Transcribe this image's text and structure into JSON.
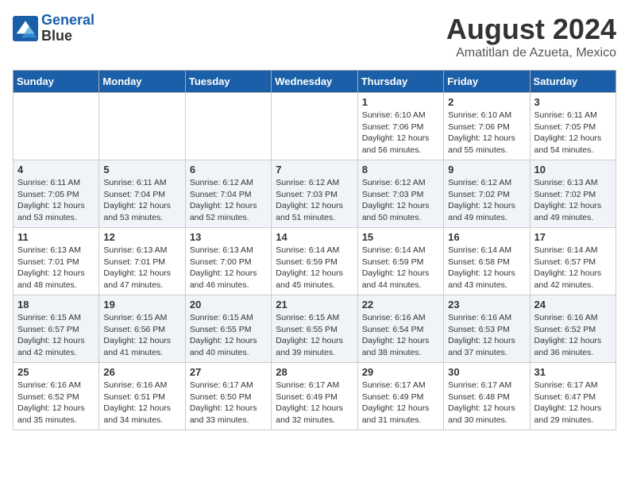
{
  "header": {
    "logo_line1": "General",
    "logo_line2": "Blue",
    "month_year": "August 2024",
    "location": "Amatitlan de Azueta, Mexico"
  },
  "days_of_week": [
    "Sunday",
    "Monday",
    "Tuesday",
    "Wednesday",
    "Thursday",
    "Friday",
    "Saturday"
  ],
  "weeks": [
    [
      {
        "num": "",
        "info": ""
      },
      {
        "num": "",
        "info": ""
      },
      {
        "num": "",
        "info": ""
      },
      {
        "num": "",
        "info": ""
      },
      {
        "num": "1",
        "info": "Sunrise: 6:10 AM\nSunset: 7:06 PM\nDaylight: 12 hours\nand 56 minutes."
      },
      {
        "num": "2",
        "info": "Sunrise: 6:10 AM\nSunset: 7:06 PM\nDaylight: 12 hours\nand 55 minutes."
      },
      {
        "num": "3",
        "info": "Sunrise: 6:11 AM\nSunset: 7:05 PM\nDaylight: 12 hours\nand 54 minutes."
      }
    ],
    [
      {
        "num": "4",
        "info": "Sunrise: 6:11 AM\nSunset: 7:05 PM\nDaylight: 12 hours\nand 53 minutes."
      },
      {
        "num": "5",
        "info": "Sunrise: 6:11 AM\nSunset: 7:04 PM\nDaylight: 12 hours\nand 53 minutes."
      },
      {
        "num": "6",
        "info": "Sunrise: 6:12 AM\nSunset: 7:04 PM\nDaylight: 12 hours\nand 52 minutes."
      },
      {
        "num": "7",
        "info": "Sunrise: 6:12 AM\nSunset: 7:03 PM\nDaylight: 12 hours\nand 51 minutes."
      },
      {
        "num": "8",
        "info": "Sunrise: 6:12 AM\nSunset: 7:03 PM\nDaylight: 12 hours\nand 50 minutes."
      },
      {
        "num": "9",
        "info": "Sunrise: 6:12 AM\nSunset: 7:02 PM\nDaylight: 12 hours\nand 49 minutes."
      },
      {
        "num": "10",
        "info": "Sunrise: 6:13 AM\nSunset: 7:02 PM\nDaylight: 12 hours\nand 49 minutes."
      }
    ],
    [
      {
        "num": "11",
        "info": "Sunrise: 6:13 AM\nSunset: 7:01 PM\nDaylight: 12 hours\nand 48 minutes."
      },
      {
        "num": "12",
        "info": "Sunrise: 6:13 AM\nSunset: 7:01 PM\nDaylight: 12 hours\nand 47 minutes."
      },
      {
        "num": "13",
        "info": "Sunrise: 6:13 AM\nSunset: 7:00 PM\nDaylight: 12 hours\nand 46 minutes."
      },
      {
        "num": "14",
        "info": "Sunrise: 6:14 AM\nSunset: 6:59 PM\nDaylight: 12 hours\nand 45 minutes."
      },
      {
        "num": "15",
        "info": "Sunrise: 6:14 AM\nSunset: 6:59 PM\nDaylight: 12 hours\nand 44 minutes."
      },
      {
        "num": "16",
        "info": "Sunrise: 6:14 AM\nSunset: 6:58 PM\nDaylight: 12 hours\nand 43 minutes."
      },
      {
        "num": "17",
        "info": "Sunrise: 6:14 AM\nSunset: 6:57 PM\nDaylight: 12 hours\nand 42 minutes."
      }
    ],
    [
      {
        "num": "18",
        "info": "Sunrise: 6:15 AM\nSunset: 6:57 PM\nDaylight: 12 hours\nand 42 minutes."
      },
      {
        "num": "19",
        "info": "Sunrise: 6:15 AM\nSunset: 6:56 PM\nDaylight: 12 hours\nand 41 minutes."
      },
      {
        "num": "20",
        "info": "Sunrise: 6:15 AM\nSunset: 6:55 PM\nDaylight: 12 hours\nand 40 minutes."
      },
      {
        "num": "21",
        "info": "Sunrise: 6:15 AM\nSunset: 6:55 PM\nDaylight: 12 hours\nand 39 minutes."
      },
      {
        "num": "22",
        "info": "Sunrise: 6:16 AM\nSunset: 6:54 PM\nDaylight: 12 hours\nand 38 minutes."
      },
      {
        "num": "23",
        "info": "Sunrise: 6:16 AM\nSunset: 6:53 PM\nDaylight: 12 hours\nand 37 minutes."
      },
      {
        "num": "24",
        "info": "Sunrise: 6:16 AM\nSunset: 6:52 PM\nDaylight: 12 hours\nand 36 minutes."
      }
    ],
    [
      {
        "num": "25",
        "info": "Sunrise: 6:16 AM\nSunset: 6:52 PM\nDaylight: 12 hours\nand 35 minutes."
      },
      {
        "num": "26",
        "info": "Sunrise: 6:16 AM\nSunset: 6:51 PM\nDaylight: 12 hours\nand 34 minutes."
      },
      {
        "num": "27",
        "info": "Sunrise: 6:17 AM\nSunset: 6:50 PM\nDaylight: 12 hours\nand 33 minutes."
      },
      {
        "num": "28",
        "info": "Sunrise: 6:17 AM\nSunset: 6:49 PM\nDaylight: 12 hours\nand 32 minutes."
      },
      {
        "num": "29",
        "info": "Sunrise: 6:17 AM\nSunset: 6:49 PM\nDaylight: 12 hours\nand 31 minutes."
      },
      {
        "num": "30",
        "info": "Sunrise: 6:17 AM\nSunset: 6:48 PM\nDaylight: 12 hours\nand 30 minutes."
      },
      {
        "num": "31",
        "info": "Sunrise: 6:17 AM\nSunset: 6:47 PM\nDaylight: 12 hours\nand 29 minutes."
      }
    ]
  ]
}
